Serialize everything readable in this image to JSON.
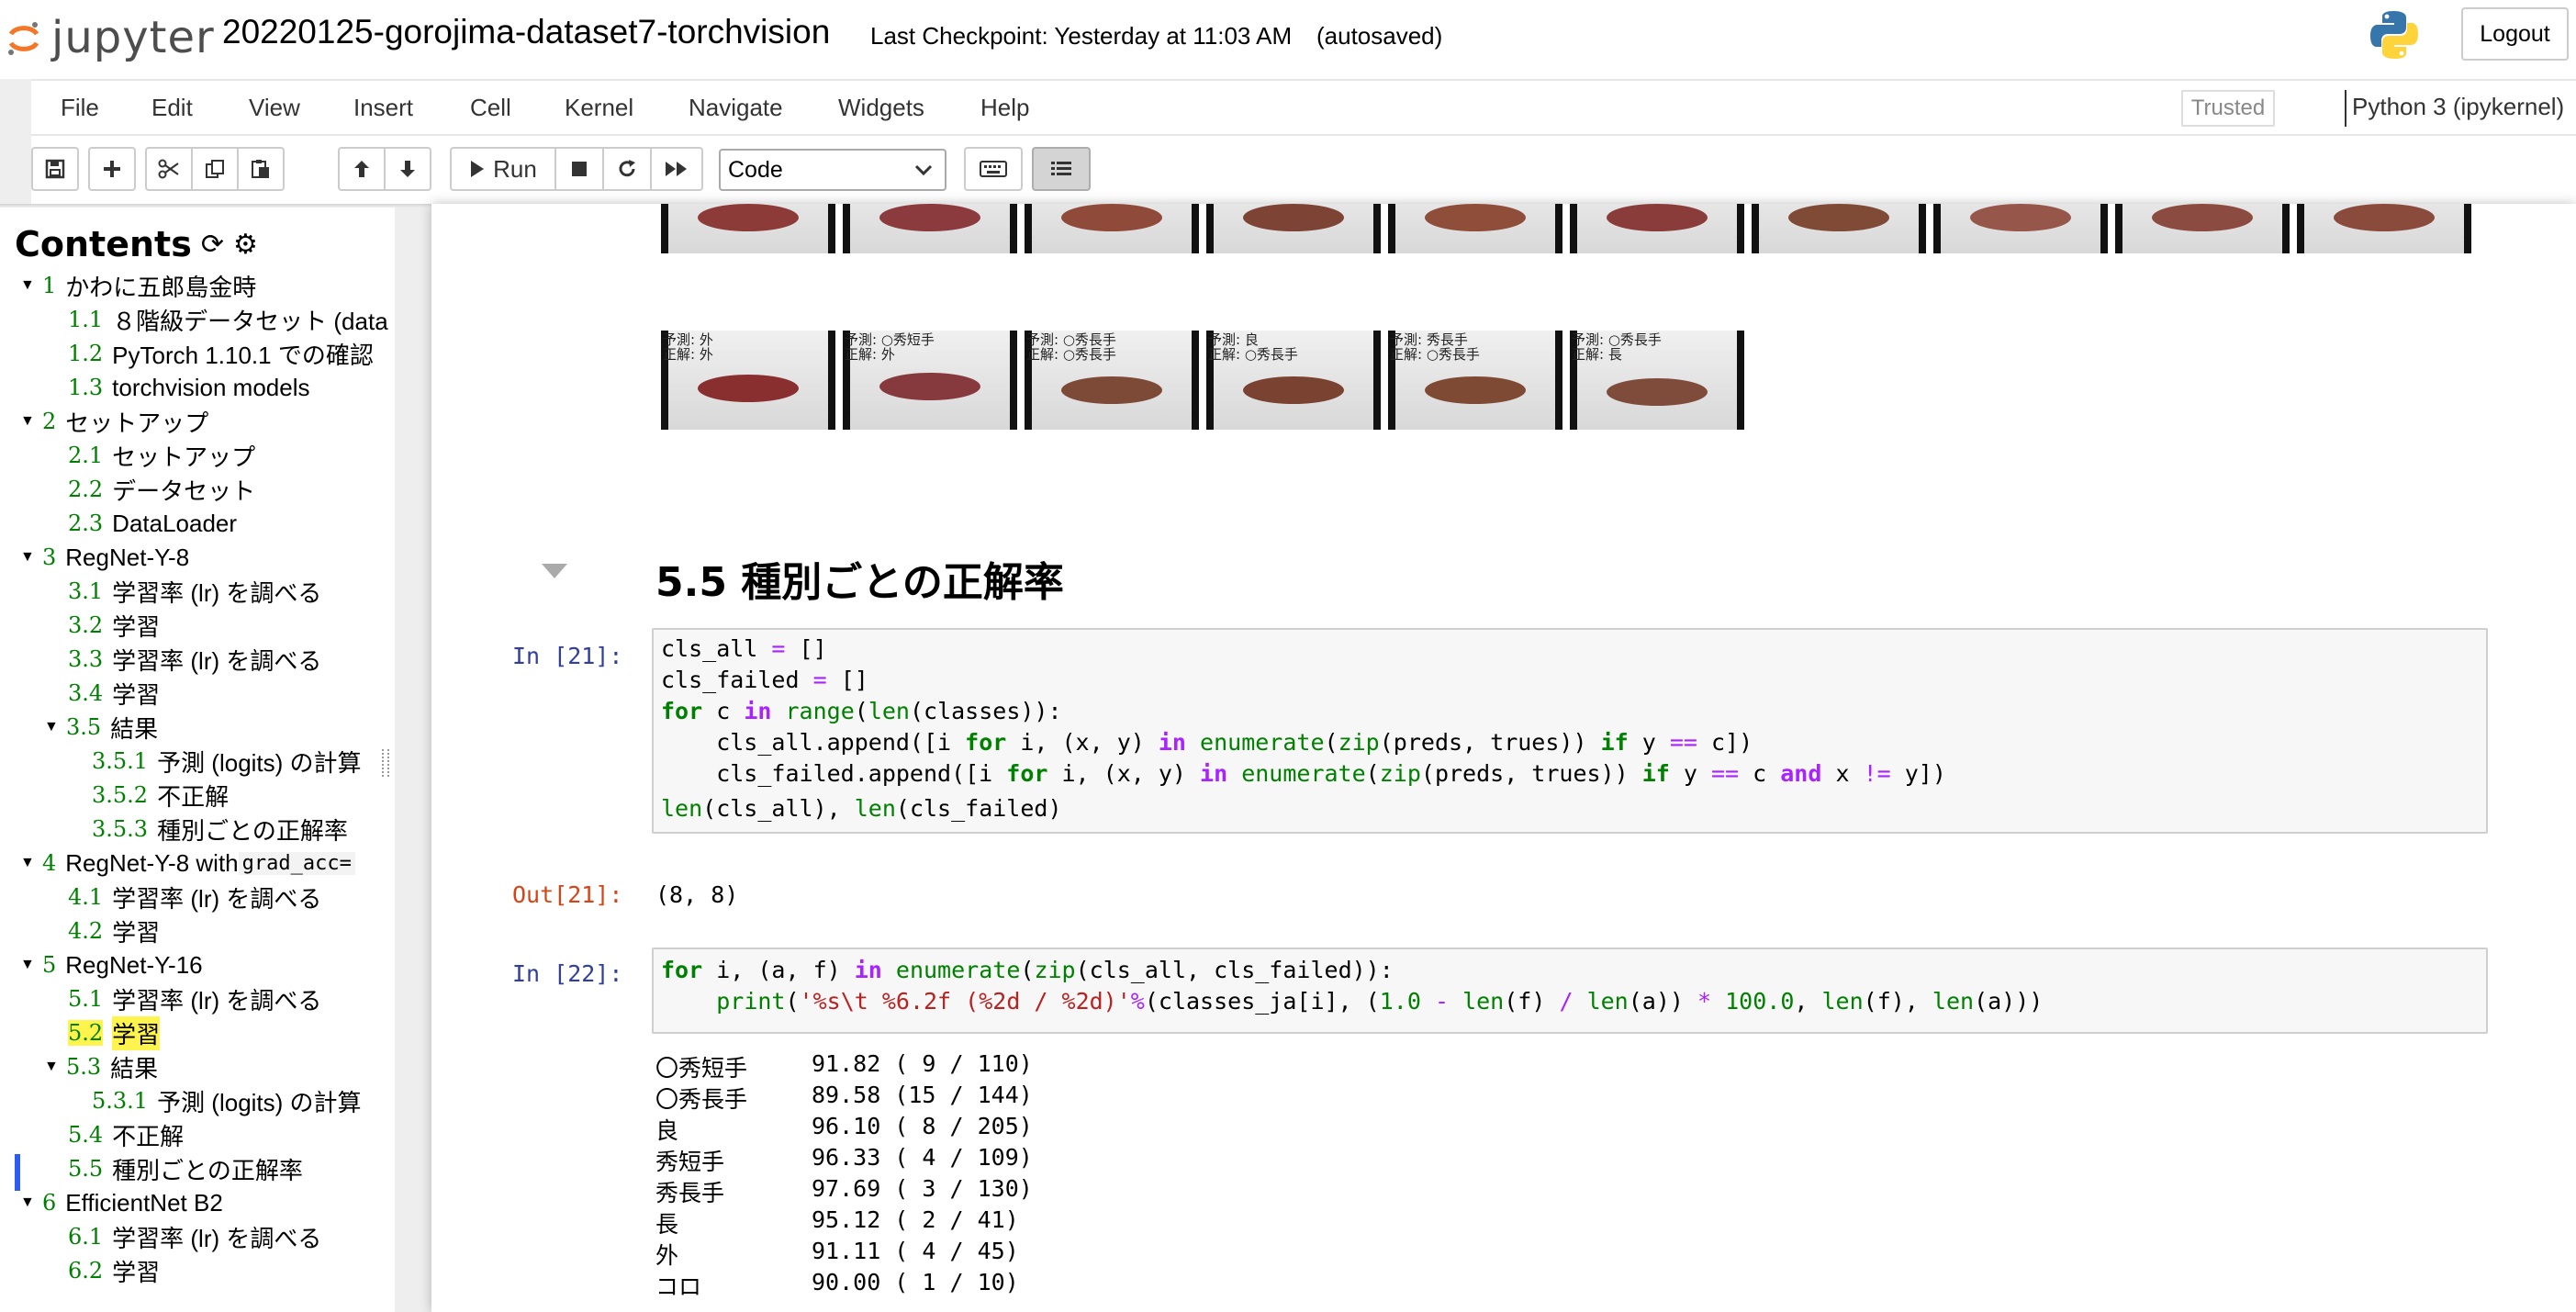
{
  "header": {
    "logo_text": "jupyter",
    "notebook_title": "20220125-gorojima-dataset7-torchvision",
    "checkpoint": "Last Checkpoint: Yesterday at 11:03 AM",
    "autosaved": "(autosaved)",
    "logout_label": "Logout"
  },
  "menu": {
    "items": [
      "File",
      "Edit",
      "View",
      "Insert",
      "Cell",
      "Kernel",
      "Navigate",
      "Widgets",
      "Help"
    ],
    "trusted": "Trusted",
    "kernel": "Python 3 (ipykernel)"
  },
  "toolbar": {
    "run_label": "Run",
    "cell_type": "Code"
  },
  "toc": {
    "title": "Contents",
    "items": [
      {
        "num": "1",
        "text": "かわに五郎島金時",
        "caret": "▼"
      },
      {
        "num": "1.1",
        "text": "８階級データセット (data"
      },
      {
        "num": "1.2",
        "text": "PyTorch 1.10.1 での確認"
      },
      {
        "num": "1.3",
        "text": "torchvision models"
      },
      {
        "num": "2",
        "text": "セットアップ",
        "caret": "▼"
      },
      {
        "num": "2.1",
        "text": "セットアップ"
      },
      {
        "num": "2.2",
        "text": "データセット"
      },
      {
        "num": "2.3",
        "text": "DataLoader"
      },
      {
        "num": "3",
        "text": "RegNet-Y-8",
        "caret": "▼"
      },
      {
        "num": "3.1",
        "text": "学習率 (lr) を調べる"
      },
      {
        "num": "3.2",
        "text": "学習"
      },
      {
        "num": "3.3",
        "text": "学習率 (lr) を調べる"
      },
      {
        "num": "3.4",
        "text": "学習"
      },
      {
        "num": "3.5",
        "text": "結果",
        "caret": "▼"
      },
      {
        "num": "3.5.1",
        "text": "予測 (logits) の計算"
      },
      {
        "num": "3.5.2",
        "text": "不正解"
      },
      {
        "num": "3.5.3",
        "text": "種別ごとの正解率"
      },
      {
        "num": "4",
        "text": "RegNet-Y-8 with ",
        "code": "grad_acc=",
        "caret": "▼"
      },
      {
        "num": "4.1",
        "text": "学習率 (lr) を調べる"
      },
      {
        "num": "4.2",
        "text": "学習"
      },
      {
        "num": "5",
        "text": "RegNet-Y-16",
        "caret": "▼"
      },
      {
        "num": "5.1",
        "text": "学習率 (lr) を調べる"
      },
      {
        "num": "5.2",
        "text": "学習"
      },
      {
        "num": "5.3",
        "text": "結果",
        "caret": "▼"
      },
      {
        "num": "5.3.1",
        "text": "予測 (logits) の計算"
      },
      {
        "num": "5.4",
        "text": "不正解"
      },
      {
        "num": "5.5",
        "text": "種別ごとの正解率"
      },
      {
        "num": "6",
        "text": "EfficientNet B2",
        "caret": "▼"
      },
      {
        "num": "6.1",
        "text": "学習率 (lr) を調べる"
      },
      {
        "num": "6.2",
        "text": "学習"
      }
    ]
  },
  "notebook": {
    "thumb_labels": [
      [
        "予測: 外",
        "正解: 外"
      ],
      [
        "予測: ○秀短手",
        "正解: 外"
      ],
      [
        "予測: ○秀長手",
        "正解: ○秀長手"
      ],
      [
        "予測: 良",
        "正解: ○秀長手"
      ],
      [
        "予測: 秀長手",
        "正解: ○秀長手"
      ],
      [
        "予測: ○秀長手",
        "正解: 長"
      ]
    ],
    "section_heading": "5.5  種別ごとの正解率",
    "cell21": {
      "in_prompt": "In [21]:",
      "out_prompt": "Out[21]:",
      "output": "(8, 8)"
    },
    "cell22": {
      "in_prompt": "In [22]:",
      "results": [
        [
          "〇秀短手",
          "91.82 ( 9 / 110)"
        ],
        [
          "〇秀長手",
          "89.58 (15 / 144)"
        ],
        [
          "良",
          "96.10 ( 8 / 205)"
        ],
        [
          "秀短手",
          "96.33 ( 4 / 109)"
        ],
        [
          "秀長手",
          "97.69 ( 3 / 130)"
        ],
        [
          "長",
          "95.12 ( 2 / 41)"
        ],
        [
          "外",
          "91.11 ( 4 / 45)"
        ],
        [
          "コロ",
          "90.00 ( 1 / 10)"
        ]
      ]
    }
  }
}
